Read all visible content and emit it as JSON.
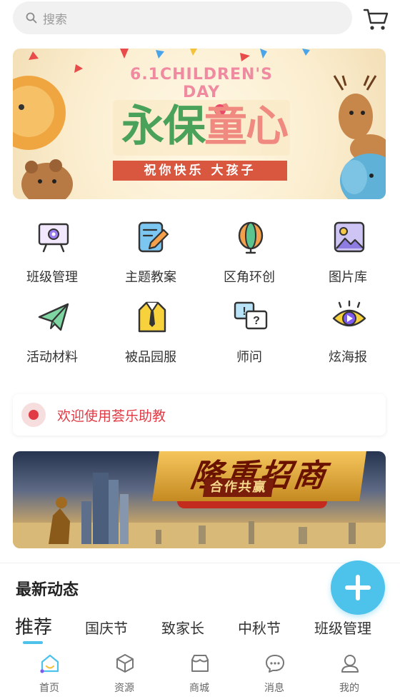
{
  "search": {
    "placeholder": "搜索"
  },
  "banner": {
    "subtitle": "6.1CHILDREN'S DAY",
    "title_part1": "永保",
    "title_part2": "童心",
    "ribbon": "祝你快乐 大孩子"
  },
  "grid": [
    {
      "label": "班级管理",
      "icon": "presentation-board-icon"
    },
    {
      "label": "主题教案",
      "icon": "edit-document-icon"
    },
    {
      "label": "区角环创",
      "icon": "lantern-icon"
    },
    {
      "label": "图片库",
      "icon": "image-icon"
    },
    {
      "label": "活动材料",
      "icon": "paper-plane-icon"
    },
    {
      "label": "被品园服",
      "icon": "uniform-icon"
    },
    {
      "label": "师问",
      "icon": "question-chat-icon"
    },
    {
      "label": "炫海报",
      "icon": "eye-play-icon"
    }
  ],
  "notice": {
    "text": "欢迎使用荟乐助教"
  },
  "ad": {
    "title": "隆重招商",
    "subtitle": "合作共赢"
  },
  "feed": {
    "title": "最新动态",
    "tabs": [
      "推荐",
      "国庆节",
      "致家长",
      "中秋节",
      "班级管理"
    ],
    "active_tab": "推荐"
  },
  "bottom_nav": [
    {
      "label": "首页",
      "icon": "home-icon",
      "active": true
    },
    {
      "label": "资源",
      "icon": "cube-icon",
      "active": false
    },
    {
      "label": "商城",
      "icon": "store-icon",
      "active": false
    },
    {
      "label": "消息",
      "icon": "message-icon",
      "active": false
    },
    {
      "label": "我的",
      "icon": "user-icon",
      "active": false
    }
  ],
  "colors": {
    "accent": "#4dc3ec",
    "notice_red": "#e13b45"
  }
}
